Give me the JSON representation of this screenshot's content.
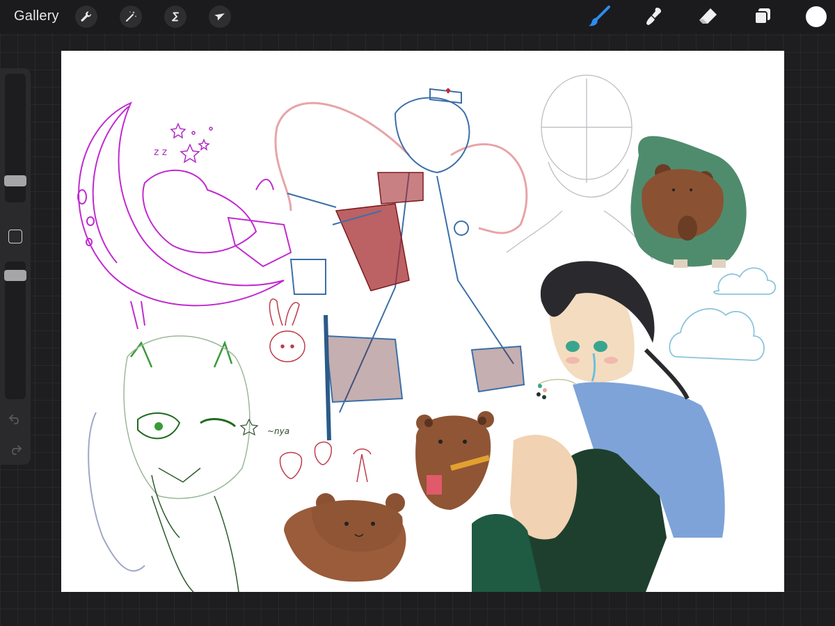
{
  "app": {
    "gallery_label": "Gallery"
  },
  "toolbar_left": [
    {
      "name": "actions",
      "icon": "wrench-icon"
    },
    {
      "name": "adjustments",
      "icon": "magic-wand-icon"
    },
    {
      "name": "selection",
      "icon": "selection-s-icon"
    },
    {
      "name": "transform",
      "icon": "arrow-cursor-icon"
    }
  ],
  "toolbar_right": [
    {
      "name": "brush",
      "icon": "brush-icon",
      "active": true
    },
    {
      "name": "smudge",
      "icon": "smudge-icon",
      "active": false
    },
    {
      "name": "eraser",
      "icon": "eraser-icon",
      "active": false
    },
    {
      "name": "layers",
      "icon": "layers-icon",
      "active": false
    }
  ],
  "current_color": "#ffffff",
  "accent_color": "#2d8cf0",
  "sidebar": {
    "brush_size_level": 0.18,
    "opacity_level": 0.95,
    "undo_icon": "undo-icon",
    "redo_icon": "redo-icon",
    "modify_icon": "square-modify-icon"
  },
  "canvas": {
    "annotations": {
      "zz": "z z",
      "nya": "~nya"
    }
  }
}
